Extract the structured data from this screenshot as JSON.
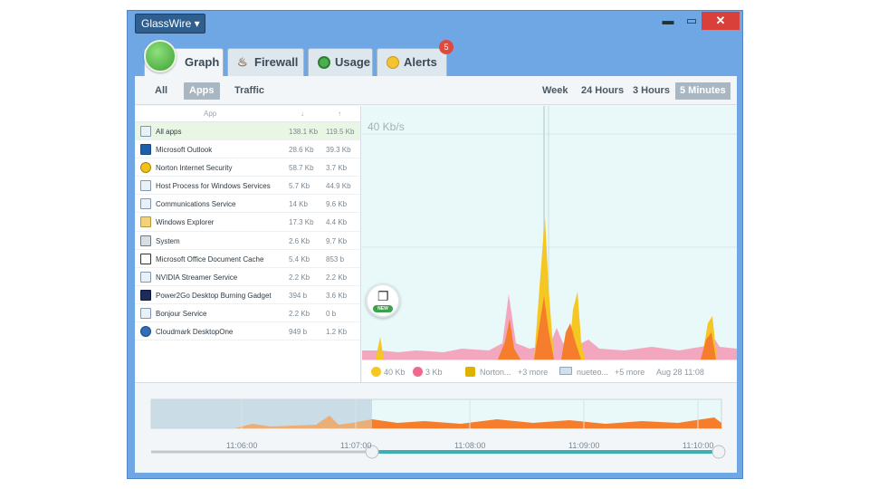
{
  "app": {
    "menu_label": "GlassWire ▾",
    "window_controls": {
      "minimize": "▬",
      "maximize": "▭",
      "close": "✕"
    }
  },
  "tabs": [
    {
      "label": "Graph",
      "icon": "glasswire-logo-icon",
      "active": true
    },
    {
      "label": "Firewall",
      "icon": "fire-icon",
      "active": false
    },
    {
      "label": "Usage",
      "icon": "pie-icon",
      "active": false
    },
    {
      "label": "Alerts",
      "icon": "bulb-icon",
      "active": false,
      "badge": "5"
    }
  ],
  "filters": [
    {
      "label": "All",
      "selected": false
    },
    {
      "label": "Apps",
      "selected": true
    },
    {
      "label": "Traffic",
      "selected": false
    }
  ],
  "ranges": [
    {
      "label": "Week",
      "selected": false
    },
    {
      "label": "24 Hours",
      "selected": false
    },
    {
      "label": "3 Hours",
      "selected": false
    },
    {
      "label": "5 Minutes",
      "selected": true
    }
  ],
  "app_list": {
    "headers": {
      "app": "App",
      "down": "↓",
      "up": "↑"
    },
    "rows": [
      {
        "name": "All apps",
        "down": "138.1 Kb",
        "up": "119.5 Kb",
        "icon": "window-icon"
      },
      {
        "name": "Microsoft Outlook",
        "down": "28.6 Kb",
        "up": "39.3 Kb",
        "icon": "outlook-icon"
      },
      {
        "name": "Norton Internet Security",
        "down": "58.7 Kb",
        "up": "3.7 Kb",
        "icon": "norton-icon"
      },
      {
        "name": "Host Process for Windows Services",
        "down": "5.7 Kb",
        "up": "44.9 Kb",
        "icon": "window-icon"
      },
      {
        "name": "Communications Service",
        "down": "14 Kb",
        "up": "9.6 Kb",
        "icon": "window-icon"
      },
      {
        "name": "Windows Explorer",
        "down": "17.3 Kb",
        "up": "4.4 Kb",
        "icon": "explorer-icon"
      },
      {
        "name": "System",
        "down": "2.6 Kb",
        "up": "9.7 Kb",
        "icon": "system-icon"
      },
      {
        "name": "Microsoft Office Document Cache",
        "down": "5.4 Kb",
        "up": "853 b",
        "icon": "document-icon"
      },
      {
        "name": "NVIDIA Streamer Service",
        "down": "2.2 Kb",
        "up": "2.2 Kb",
        "icon": "window-icon"
      },
      {
        "name": "Power2Go Desktop Burning Gadget",
        "down": "394 b",
        "up": "3.6 Kb",
        "icon": "power2go-icon"
      },
      {
        "name": "Bonjour Service",
        "down": "2.2 Kb",
        "up": "0 b",
        "icon": "window-icon"
      },
      {
        "name": "Cloudmark DesktopOne",
        "down": "949 b",
        "up": "1.2 Kb",
        "icon": "cloudmark-icon"
      }
    ]
  },
  "graph": {
    "scale_label": "40 Kb/s",
    "new_badge": "NEW",
    "colors": {
      "download": "#f5c722",
      "upload": "#f06a8e",
      "overlap": "#f57d2b",
      "background": "#e9f8f8"
    }
  },
  "legend": {
    "down_value": "40 Kb",
    "up_value": "3 Kb",
    "app1": "Norton...",
    "app1_more": "+3 more",
    "app2": "nueteo...",
    "app2_more": "+5 more",
    "timestamp": "Aug 28 11:08"
  },
  "timeline": {
    "labels": [
      "11:06:00",
      "11:07:00",
      "11:08:00",
      "11:09:00",
      "11:10:00"
    ]
  }
}
